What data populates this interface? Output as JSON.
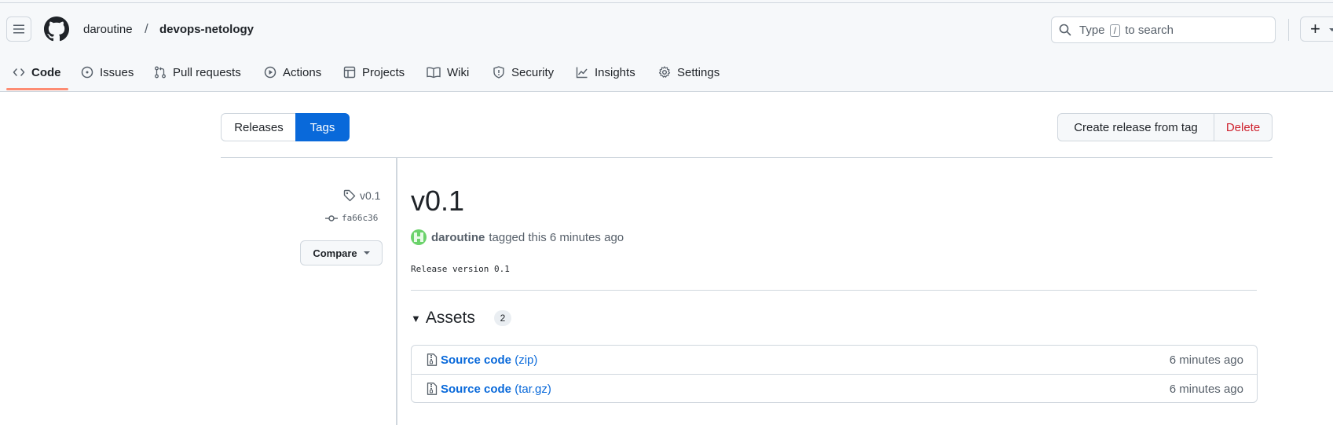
{
  "header": {
    "owner": "daroutine",
    "separator": "/",
    "repo": "devops-netology",
    "search": {
      "prefix": "Type",
      "key": "/",
      "suffix": "to search"
    },
    "plus": "+"
  },
  "tabs": [
    {
      "label": "Code",
      "icon": "code-icon",
      "active": true
    },
    {
      "label": "Issues",
      "icon": "issue-opened-icon"
    },
    {
      "label": "Pull requests",
      "icon": "git-pull-request-icon"
    },
    {
      "label": "Actions",
      "icon": "play-icon"
    },
    {
      "label": "Projects",
      "icon": "table-icon"
    },
    {
      "label": "Wiki",
      "icon": "book-icon"
    },
    {
      "label": "Security",
      "icon": "shield-icon"
    },
    {
      "label": "Insights",
      "icon": "graph-icon"
    },
    {
      "label": "Settings",
      "icon": "gear-icon"
    }
  ],
  "toggle": {
    "releases": "Releases",
    "tags": "Tags",
    "selected": "Tags"
  },
  "actions": {
    "create": "Create release from tag",
    "delete": "Delete"
  },
  "sidebar": {
    "tag": "v0.1",
    "commit": "fa66c36",
    "compare": "Compare"
  },
  "release": {
    "title": "v0.1",
    "author": "daroutine",
    "tagged_text": "tagged this 6 minutes ago",
    "body": "Release version 0.1"
  },
  "assets": {
    "heading": "Assets",
    "count": "2",
    "items": [
      {
        "name": "Source code",
        "ext": "(zip)",
        "time": "6 minutes ago"
      },
      {
        "name": "Source code",
        "ext": "(tar.gz)",
        "time": "6 minutes ago"
      }
    ]
  },
  "colors": {
    "accent": "#0969da",
    "danger": "#cf222e",
    "tab_underline": "#fd8c73",
    "border": "#d0d7de"
  }
}
